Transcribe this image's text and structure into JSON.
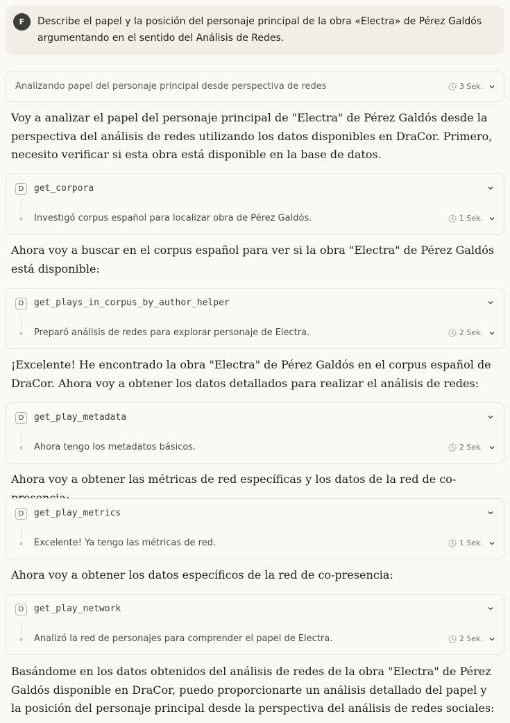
{
  "user": {
    "avatar_letter": "F",
    "message": "Describe el papel y la posición del personaje principal de la obra «Electra» de Pérez Galdós argumentando en el sentido del Análisis de Redes."
  },
  "thinking": {
    "label": "Analizando papel del personaje principal desde perspectiva de redes",
    "duration": "3 Sek."
  },
  "paragraphs": [
    "Voy a analizar el papel del personaje principal de \"Electra\" de Pérez Galdós desde la perspectiva del análisis de redes utilizando los datos disponibles en DraCor. Primero, necesito verificar si esta obra está disponible en la base de datos.",
    "Ahora voy a buscar en el corpus español para ver si la obra \"Electra\" de Pérez Galdós está disponible:",
    "¡Excelente! He encontrado la obra \"Electra\" de Pérez Galdós en el corpus español de DraCor. Ahora voy a obtener los datos detallados para realizar el análisis de redes:",
    "Ahora voy a obtener las métricas de red específicas y los datos de la red de co-presencia:",
    "Ahora voy a obtener los datos específicos de la red de co-presencia:",
    "Basándome en los datos obtenidos del análisis de redes de la obra \"Electra\" de Pérez Galdós disponible en DraCor, puedo proporcionarte un análisis detallado del papel y la posición del personaje principal desde la perspectiva del análisis de redes sociales:"
  ],
  "tools": [
    {
      "icon": "D",
      "name": "get_corpora",
      "summary": "Investigó corpus español para localizar obra de Pérez Galdós.",
      "duration": "1 Sek."
    },
    {
      "icon": "D",
      "name": "get_plays_in_corpus_by_author_helper",
      "summary": "Preparó análisis de redes para explorar personaje de Electra.",
      "duration": "2 Sek."
    },
    {
      "icon": "D",
      "name": "get_play_metadata",
      "summary": "Ahora tengo los metadatos básicos.",
      "duration": "2 Sek."
    },
    {
      "icon": "D",
      "name": "get_play_metrics",
      "summary": "Excelente! Ya tengo las métricas de red.",
      "duration": "1 Sek."
    },
    {
      "icon": "D",
      "name": "get_play_network",
      "summary": "Analizó la red de personajes para comprender el papel de Electra.",
      "duration": "2 Sek."
    }
  ],
  "icons": {
    "clock": "clock-icon",
    "chevron": "chevron-down-icon",
    "tool": "dracor-tool-icon"
  }
}
